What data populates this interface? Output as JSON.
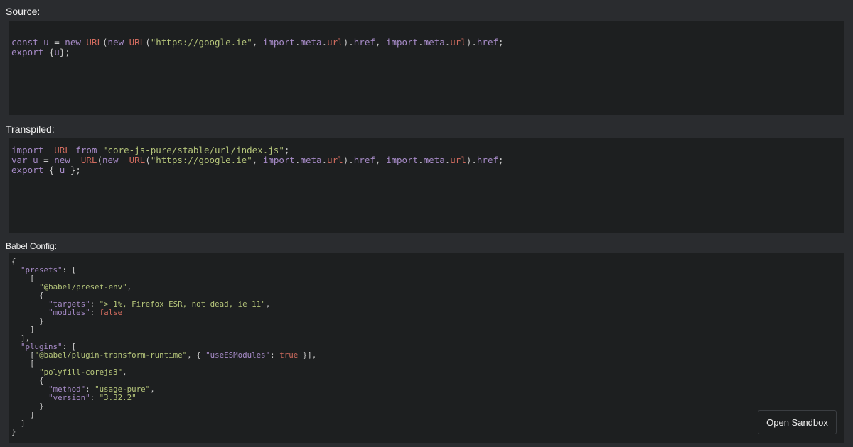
{
  "source": {
    "title": "Source:",
    "lines": [
      "",
      "const u = new URL(new URL(\"https://google.ie\", import.meta.url).href, import.meta.url).href;",
      "export {u};"
    ]
  },
  "transpiled": {
    "title": "Transpiled:",
    "lines": [
      "import _URL from \"core-js-pure/stable/url/index.js\";",
      "var u = new _URL(new _URL(\"https://google.ie\", import.meta.url).href, import.meta.url).href;",
      "export { u };"
    ]
  },
  "config": {
    "title": "Babel Config:",
    "lines": [
      "{",
      "  \"presets\": [",
      "    [",
      "      \"@babel/preset-env\",",
      "      {",
      "        \"targets\": \"> 1%, Firefox ESR, not dead, ie 11\",",
      "        \"modules\": false",
      "      }",
      "    ]",
      "  ],",
      "  \"plugins\": [",
      "    [\"@babel/plugin-transform-runtime\", { \"useESModules\": true }],",
      "    [",
      "      \"polyfill-corejs3\",",
      "      {",
      "        \"method\": \"usage-pure\",",
      "        \"version\": \"3.32.2\"",
      "      }",
      "    ]",
      "  ]",
      "}"
    ]
  },
  "actions": {
    "open_sandbox": "Open Sandbox"
  }
}
